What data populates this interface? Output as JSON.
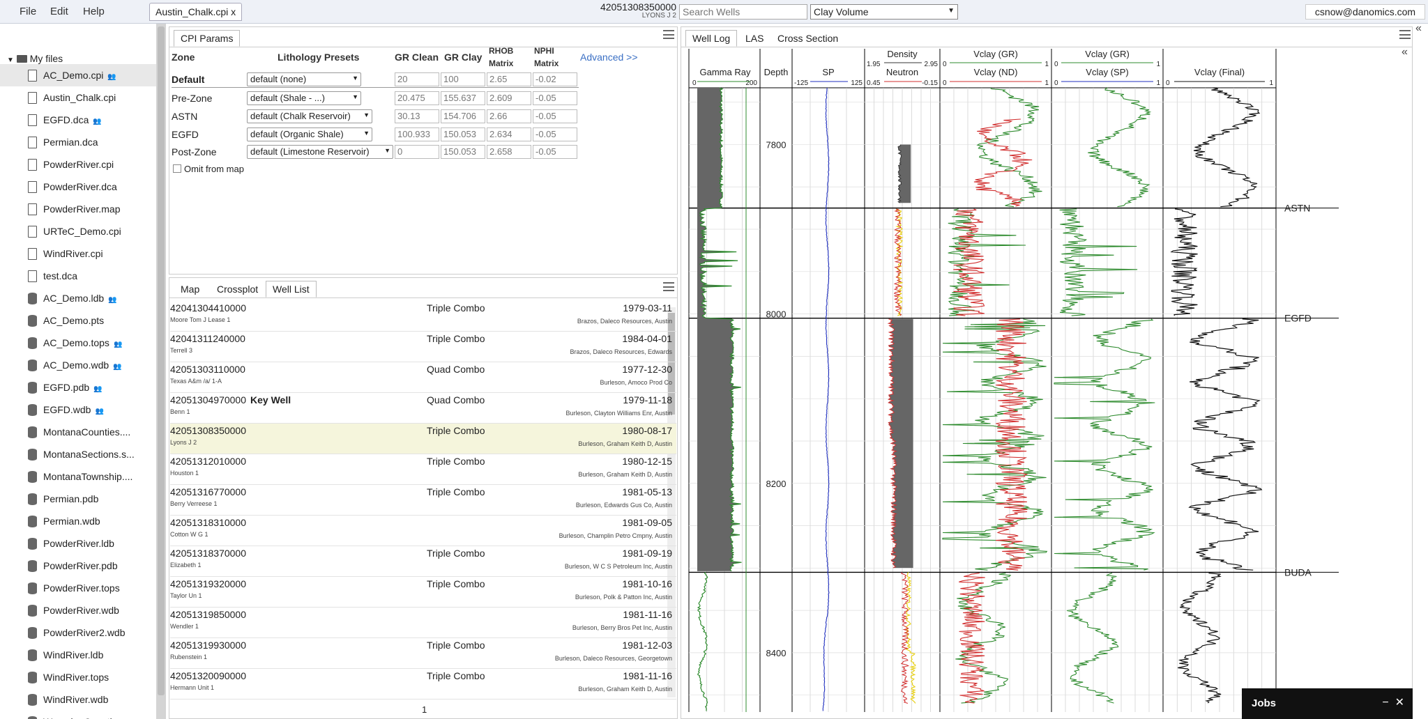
{
  "menu": {
    "file": "File",
    "edit": "Edit",
    "help": "Help"
  },
  "file_tab": "Austin_Chalk.cpi x",
  "well_header": {
    "id": "42051308350000",
    "name": "LYONS J 2"
  },
  "search": {
    "placeholder": "Search Wells"
  },
  "property_select": "Clay Volume",
  "user_email": "csnow@danomics.com",
  "sidebar": {
    "folder": "My files",
    "files": [
      {
        "name": "AC_Demo.cpi",
        "kind": "doc",
        "shared": true,
        "selected": true
      },
      {
        "name": "Austin_Chalk.cpi",
        "kind": "doc",
        "shared": false
      },
      {
        "name": "EGFD.dca",
        "kind": "doc",
        "shared": true
      },
      {
        "name": "Permian.dca",
        "kind": "doc",
        "shared": false
      },
      {
        "name": "PowderRiver.cpi",
        "kind": "doc",
        "shared": false
      },
      {
        "name": "PowderRiver.dca",
        "kind": "doc",
        "shared": false
      },
      {
        "name": "PowderRiver.map",
        "kind": "doc",
        "shared": false
      },
      {
        "name": "URTeC_Demo.cpi",
        "kind": "doc",
        "shared": false
      },
      {
        "name": "WindRiver.cpi",
        "kind": "doc",
        "shared": false
      },
      {
        "name": "test.dca",
        "kind": "doc",
        "shared": false
      },
      {
        "name": "AC_Demo.ldb",
        "kind": "db",
        "shared": true
      },
      {
        "name": "AC_Demo.pts",
        "kind": "db",
        "shared": false
      },
      {
        "name": "AC_Demo.tops",
        "kind": "db",
        "shared": true
      },
      {
        "name": "AC_Demo.wdb",
        "kind": "db",
        "shared": true
      },
      {
        "name": "EGFD.pdb",
        "kind": "db",
        "shared": true
      },
      {
        "name": "EGFD.wdb",
        "kind": "db",
        "shared": true
      },
      {
        "name": "MontanaCounties....",
        "kind": "db",
        "shared": false
      },
      {
        "name": "MontanaSections.s...",
        "kind": "db",
        "shared": false
      },
      {
        "name": "MontanaTownship....",
        "kind": "db",
        "shared": false
      },
      {
        "name": "Permian.pdb",
        "kind": "db",
        "shared": false
      },
      {
        "name": "Permian.wdb",
        "kind": "db",
        "shared": false
      },
      {
        "name": "PowderRiver.ldb",
        "kind": "db",
        "shared": false
      },
      {
        "name": "PowderRiver.pdb",
        "kind": "db",
        "shared": false
      },
      {
        "name": "PowderRiver.tops",
        "kind": "db",
        "shared": false
      },
      {
        "name": "PowderRiver.wdb",
        "kind": "db",
        "shared": false
      },
      {
        "name": "PowderRiver2.wdb",
        "kind": "db",
        "shared": false
      },
      {
        "name": "WindRiver.ldb",
        "kind": "db",
        "shared": false
      },
      {
        "name": "WindRiver.tops",
        "kind": "db",
        "shared": false
      },
      {
        "name": "WindRiver.wdb",
        "kind": "db",
        "shared": false
      },
      {
        "name": "WyomingCounties....",
        "kind": "db",
        "shared": false
      }
    ]
  },
  "cpi": {
    "tab": "CPI Params",
    "headers": {
      "zone": "Zone",
      "presets": "Lithology Presets",
      "grclean": "GR Clean",
      "grclay": "GR Clay",
      "rhob1": "RHOB",
      "rhob2": "Matrix",
      "nphi1": "NPHI",
      "nphi2": "Matrix"
    },
    "advanced": "Advanced >>",
    "omit": "Omit from map",
    "rows": [
      {
        "zone": "Default",
        "preset": "default (none)",
        "grclean": "20",
        "grclay": "100",
        "rhob": "2.65",
        "nphi": "-0.02",
        "bold": true
      },
      {
        "zone": "Pre-Zone",
        "preset": "default (Shale - ...)",
        "grclean": "20.475",
        "grclay": "155.637",
        "rhob": "2.609",
        "nphi": "-0.05"
      },
      {
        "zone": "ASTN",
        "preset": "default (Chalk Reservoir)",
        "grclean": "30.13",
        "grclay": "154.706",
        "rhob": "2.66",
        "nphi": "-0.05"
      },
      {
        "zone": "EGFD",
        "preset": "default (Organic Shale)",
        "grclean": "100.933",
        "grclay": "150.053",
        "rhob": "2.634",
        "nphi": "-0.05"
      },
      {
        "zone": "Post-Zone",
        "preset": "default (Limestone Reservoir)",
        "grclean": "0",
        "grclay": "150.053",
        "rhob": "2.658",
        "nphi": "-0.05"
      }
    ]
  },
  "lower_tabs": {
    "map": "Map",
    "crossplot": "Crossplot",
    "welllist": "Well List"
  },
  "wells": [
    {
      "id": "42041304410000",
      "name": "Moore Tom J Lease 1",
      "type": "Triple Combo",
      "date": "1979-03-11",
      "op": "Brazos, Daleco Resources, Austin"
    },
    {
      "id": "42041311240000",
      "name": "Terrell 3",
      "type": "Triple Combo",
      "date": "1984-04-01",
      "op": "Brazos, Daleco Resources, Edwards"
    },
    {
      "id": "42051303110000",
      "name": "Texas A&m /a/ 1-A",
      "type": "Quad Combo",
      "date": "1977-12-30",
      "op": "Burleson, Amoco Prod Co"
    },
    {
      "id": "42051304970000",
      "name": "Benn 1",
      "type": "Quad Combo",
      "date": "1979-11-18",
      "op": "Burleson, Clayton Williams Enr, Austin",
      "key": "Key Well"
    },
    {
      "id": "42051308350000",
      "name": "Lyons J 2",
      "type": "Triple Combo",
      "date": "1980-08-17",
      "op": "Burleson, Graham Keith D, Austin",
      "hl": true
    },
    {
      "id": "42051312010000",
      "name": "Houston 1",
      "type": "Triple Combo",
      "date": "1980-12-15",
      "op": "Burleson, Graham Keith D, Austin"
    },
    {
      "id": "42051316770000",
      "name": "Berry Verreese 1",
      "type": "Triple Combo",
      "date": "1981-05-13",
      "op": "Burleson, Edwards Gus Co, Austin"
    },
    {
      "id": "42051318310000",
      "name": "Cotton W G 1",
      "type": "",
      "date": "1981-09-05",
      "op": "Burleson, Champlin Petro Cmpny, Austin"
    },
    {
      "id": "42051318370000",
      "name": "Elizabeth 1",
      "type": "Triple Combo",
      "date": "1981-09-19",
      "op": "Burleson, W C S Petroleum Inc, Austin"
    },
    {
      "id": "42051319320000",
      "name": "Taylor Un 1",
      "type": "Triple Combo",
      "date": "1981-10-16",
      "op": "Burleson, Polk & Patton Inc, Austin"
    },
    {
      "id": "42051319850000",
      "name": "Wendler 1",
      "type": "",
      "date": "1981-11-16",
      "op": "Burleson, Berry Bros Pet Inc, Austin"
    },
    {
      "id": "42051319930000",
      "name": "Rubenstein 1",
      "type": "Triple Combo",
      "date": "1981-12-03",
      "op": "Burleson, Daleco Resources, Georgetown"
    },
    {
      "id": "42051320090000",
      "name": "Hermann Unit 1",
      "type": "Triple Combo",
      "date": "1981-11-16",
      "op": "Burleson, Graham Keith D, Austin"
    }
  ],
  "page_number": "1",
  "log_tabs": {
    "welllog": "Well Log",
    "las": "LAS",
    "cross": "Cross Section"
  },
  "tracks": {
    "gr": {
      "title": "Gamma Ray",
      "min": "0",
      "max": "200"
    },
    "depth": "Depth",
    "sp": {
      "title": "SP",
      "min": "-125",
      "max": "125"
    },
    "dens": {
      "title1": "Density",
      "min1": "1.95",
      "max1": "2.95",
      "title2": "Neutron",
      "min2": "0.45",
      "max2": "-0.15"
    },
    "v1": {
      "title1": "Vclay (GR)",
      "title2": "Vclay (ND)",
      "min": "0",
      "max": "1"
    },
    "v2": {
      "title1": "Vclay (GR)",
      "title2": "Vclay (SP)",
      "min": "0",
      "max": "1"
    },
    "v3": {
      "title": "Vclay (Final)",
      "min": "0",
      "max": "1"
    }
  },
  "depth_labels": [
    "7800",
    "8000",
    "8200",
    "8400"
  ],
  "tops": [
    "ASTN",
    "EGFD",
    "BUDA"
  ],
  "colors": {
    "gr": "#2e8b2e",
    "sp": "#1f2fbf",
    "nd": "#d22f2f",
    "yellow": "#e8d11a",
    "fill": "#666666",
    "final": "#111111"
  },
  "jobs": {
    "label": "Jobs",
    "minimize": "−",
    "close": "✕"
  },
  "collapse_icon": "«"
}
